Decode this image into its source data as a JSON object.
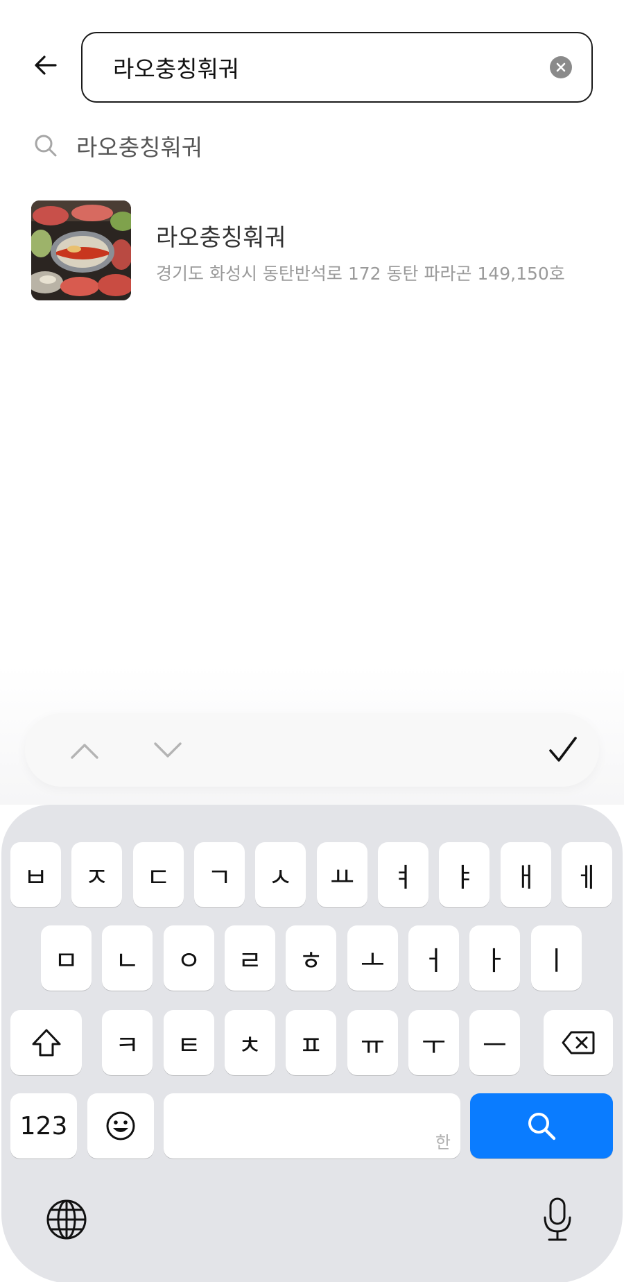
{
  "search": {
    "query": "라오충칭훠궈",
    "back_icon": "arrow-left-icon",
    "clear_icon": "clear-circle-icon"
  },
  "suggestion": {
    "icon": "search-icon",
    "text": "라오충칭훠궈"
  },
  "results": [
    {
      "name": "라오충칭훠궈",
      "address": "경기도 화성시 동탄반석로 172 동탄 파라곤 149,150호",
      "thumbnail": "hotpot-thumbnail"
    }
  ],
  "accessory_bar": {
    "prev_icon": "chevron-up-icon",
    "next_icon": "chevron-down-icon",
    "done_icon": "checkmark-icon"
  },
  "keyboard": {
    "row1": [
      "ㅂ",
      "ㅈ",
      "ㄷ",
      "ㄱ",
      "ㅅ",
      "ㅛ",
      "ㅕ",
      "ㅑ",
      "ㅐ",
      "ㅔ"
    ],
    "row2": [
      "ㅁ",
      "ㄴ",
      "ㅇ",
      "ㄹ",
      "ㅎ",
      "ㅗ",
      "ㅓ",
      "ㅏ",
      "ㅣ"
    ],
    "row3": [
      "ㅋ",
      "ㅌ",
      "ㅊ",
      "ㅍ",
      "ㅠ",
      "ㅜ",
      "ㅡ"
    ],
    "numbers_label": "123",
    "space_hint": "한",
    "shift_icon": "shift-arrow-icon",
    "delete_icon": "backspace-icon",
    "emoji_icon": "emoji-icon",
    "search_icon": "search-icon",
    "globe_icon": "globe-icon",
    "mic_icon": "microphone-icon",
    "search_key_color": "#0a7cff"
  }
}
